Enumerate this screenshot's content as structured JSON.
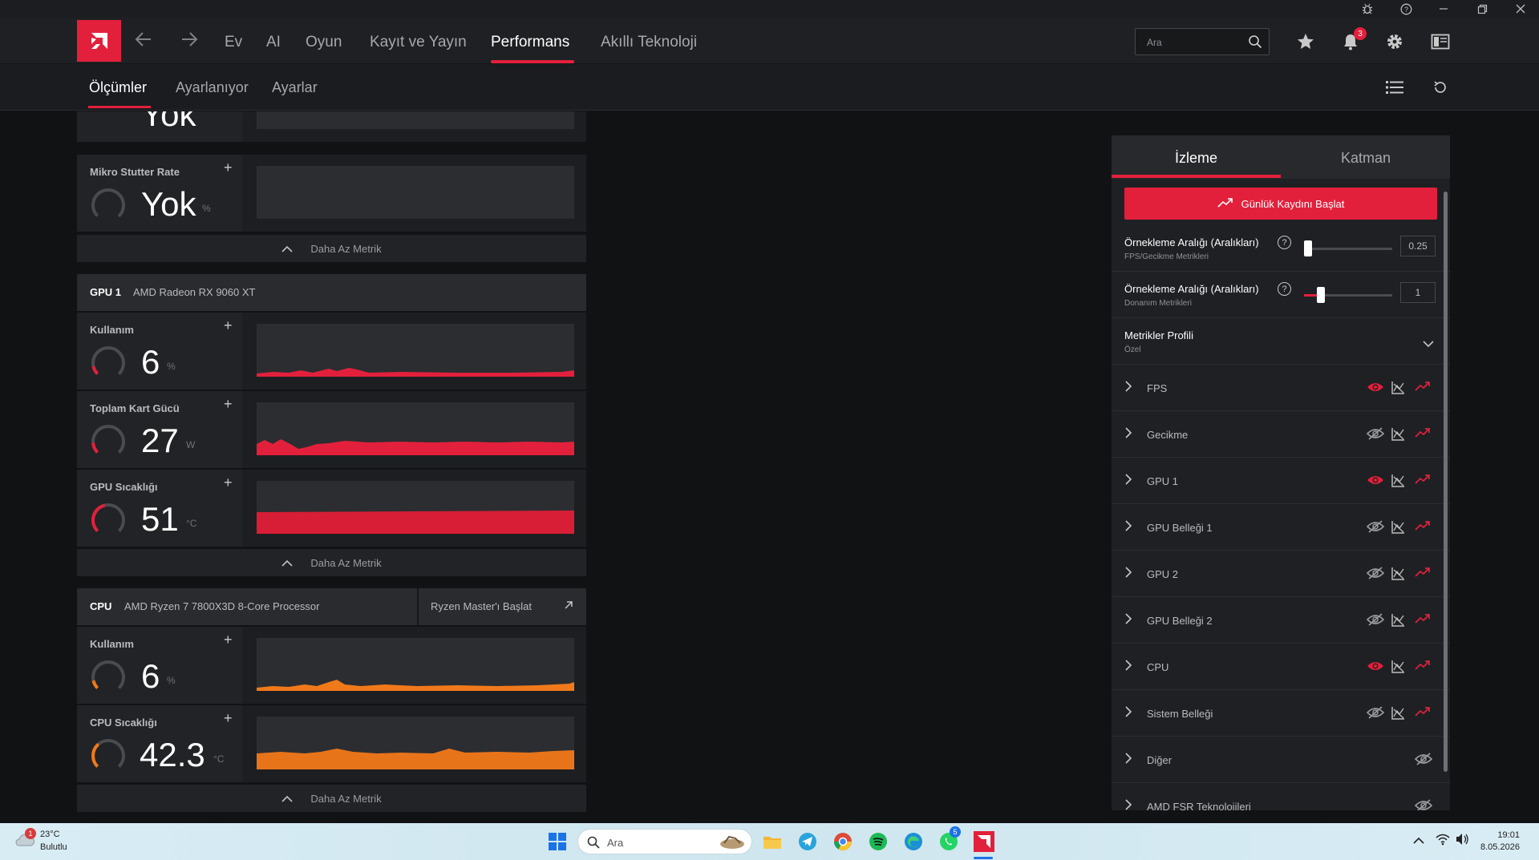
{
  "nav": {
    "items": [
      "Ev",
      "AI",
      "Oyun",
      "Kayıt ve Yayın",
      "Performans",
      "Akıllı Teknoloji"
    ],
    "active": "Performans",
    "search_placeholder": "Ara",
    "notification_count": "3"
  },
  "subnav": {
    "items": [
      "Ölçümler",
      "Ayarlanıyor",
      "Ayarlar"
    ],
    "active": "Ölçümler"
  },
  "top_section": {
    "partial_value": "Yok",
    "micro_stutter": {
      "name": "Mikro Stutter Rate",
      "value": "Yok",
      "unit": "%"
    },
    "less_label": "Daha Az Metrik"
  },
  "gpu": {
    "label": "GPU 1",
    "model": "AMD Radeon RX 9060 XT",
    "metrics": [
      {
        "name": "Kullanım",
        "value": "6",
        "unit": "%",
        "gauge_fraction": 0.06,
        "color": "#e3203c"
      },
      {
        "name": "Toplam Kart Gücü",
        "value": "27",
        "unit": "W",
        "gauge_fraction": 0.15,
        "color": "#e3203c"
      },
      {
        "name": "GPU Sıcaklığı",
        "value": "51",
        "unit": "°C",
        "gauge_fraction": 0.45,
        "color": "#e3203c"
      }
    ],
    "less_label": "Daha Az Metrik"
  },
  "cpu": {
    "label": "CPU",
    "model": "AMD Ryzen 7 7800X3D 8-Core Processor",
    "ryzen_master": "Ryzen Master'ı Başlat",
    "metrics": [
      {
        "name": "Kullanım",
        "value": "6",
        "unit": "%",
        "gauge_fraction": 0.06,
        "color": "#f07a1a"
      },
      {
        "name": "CPU Sıcaklığı",
        "value": "42.3",
        "unit": "°C",
        "gauge_fraction": 0.35,
        "color": "#f07a1a"
      }
    ],
    "less_label": "Daha Az Metrik"
  },
  "right_panel": {
    "tabs": [
      "İzleme",
      "Katman"
    ],
    "active_tab": "İzleme",
    "start_button": "Günlük Kaydını Başlat",
    "sampling1": {
      "title": "Örnekleme Aralığı (Aralıkları)",
      "subtitle": "FPS/Gecikme Metrikleri",
      "value": "0.25",
      "fraction": 0.05
    },
    "sampling2": {
      "title": "Örnekleme Aralığı (Aralıkları)",
      "subtitle": "Donanım Metrikleri",
      "value": "1",
      "fraction": 0.2
    },
    "profile": {
      "title": "Metrikler Profili",
      "value": "Özel"
    },
    "rows": [
      {
        "label": "FPS",
        "visible": true
      },
      {
        "label": "Gecikme",
        "visible": false
      },
      {
        "label": "GPU 1",
        "visible": true
      },
      {
        "label": "GPU Belleği 1",
        "visible": false
      },
      {
        "label": "GPU 2",
        "visible": false
      },
      {
        "label": "GPU Belleği 2",
        "visible": false
      },
      {
        "label": "CPU",
        "visible": true
      },
      {
        "label": "Sistem Belleği",
        "visible": false
      },
      {
        "label": "Diğer",
        "visible": false
      },
      {
        "label": "AMD FSR Teknolojileri",
        "visible": false
      }
    ]
  },
  "taskbar": {
    "weather_temp": "23°C",
    "weather_desc": "Bulutlu",
    "weather_badge": "1",
    "search_placeholder": "Ara",
    "time": "19:01",
    "date": "8.05.2026",
    "whatsapp_badge": "5"
  },
  "colors": {
    "accent": "#e3203c",
    "cpu": "#f07a1a"
  }
}
